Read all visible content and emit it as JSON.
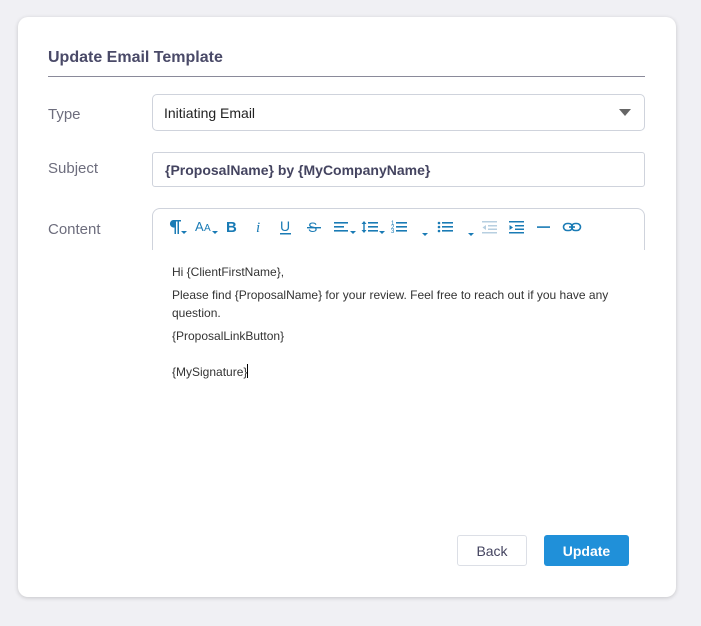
{
  "dialog": {
    "title": "Update Email Template"
  },
  "form": {
    "type_label": "Type",
    "type_value": "Initiating Email",
    "subject_label": "Subject",
    "subject_value": "{ProposalName} by {MyCompanyName}",
    "content_label": "Content"
  },
  "toolbar": {
    "items": [
      "paragraph-format-icon",
      "font-size-icon",
      "bold-icon",
      "italic-icon",
      "underline-icon",
      "strikethrough-icon",
      "align-icon",
      "line-height-icon",
      "ordered-list-icon",
      "unordered-list-icon",
      "outdent-icon",
      "indent-icon",
      "horizontal-line-icon",
      "link-icon"
    ],
    "accent_color": "#1a7bb5"
  },
  "content": {
    "line1": "Hi {ClientFirstName},",
    "line2": "Please find  {ProposalName} for your review. Feel free to reach out if you have any question.",
    "line3": "{ProposalLinkButton}",
    "line4": "{MySignature}"
  },
  "buttons": {
    "back_label": "Back",
    "update_label": "Update",
    "primary_color": "#2090d9"
  }
}
